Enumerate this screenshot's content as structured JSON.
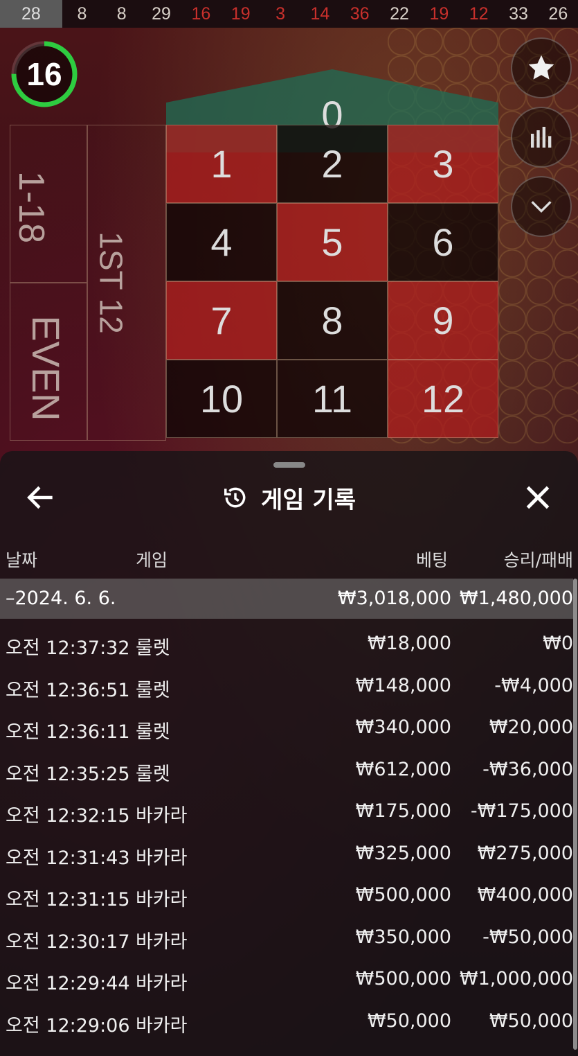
{
  "history_strip": [
    {
      "value": "28",
      "color": "current"
    },
    {
      "value": "8",
      "color": "black"
    },
    {
      "value": "8",
      "color": "black"
    },
    {
      "value": "29",
      "color": "black"
    },
    {
      "value": "16",
      "color": "red"
    },
    {
      "value": "19",
      "color": "red"
    },
    {
      "value": "3",
      "color": "red"
    },
    {
      "value": "14",
      "color": "red"
    },
    {
      "value": "36",
      "color": "red"
    },
    {
      "value": "22",
      "color": "black"
    },
    {
      "value": "19",
      "color": "red"
    },
    {
      "value": "12",
      "color": "red"
    },
    {
      "value": "33",
      "color": "black"
    },
    {
      "value": "26",
      "color": "black"
    }
  ],
  "timer": {
    "value": "16",
    "progress": 0.75,
    "color": "#2ecc40"
  },
  "board": {
    "zero": "0",
    "numbers": [
      {
        "n": "1",
        "color": "red"
      },
      {
        "n": "2",
        "color": "black"
      },
      {
        "n": "3",
        "color": "red"
      },
      {
        "n": "4",
        "color": "black"
      },
      {
        "n": "5",
        "color": "red"
      },
      {
        "n": "6",
        "color": "black"
      },
      {
        "n": "7",
        "color": "red"
      },
      {
        "n": "8",
        "color": "black"
      },
      {
        "n": "9",
        "color": "red"
      },
      {
        "n": "10",
        "color": "black"
      },
      {
        "n": "11",
        "color": "black"
      },
      {
        "n": "12",
        "color": "red"
      }
    ],
    "low_label": "1-18",
    "even_label": "EVEN",
    "dozen_label": "1ST 12"
  },
  "right_buttons": [
    "star-icon",
    "stats-icon",
    "chevron-down-icon"
  ],
  "sheet": {
    "title": "게임 기록",
    "columns": {
      "date": "날짜",
      "game": "게임",
      "bet": "베팅",
      "result": "승리/패배"
    },
    "summary": {
      "date": "–2024. 6. 6.",
      "bet": "₩3,018,000",
      "result": "₩1,480,000"
    },
    "rows": [
      {
        "time": "오전 12:37:32",
        "game": "룰렛",
        "bet": "₩18,000",
        "result": "₩0"
      },
      {
        "time": "오전 12:36:51",
        "game": "룰렛",
        "bet": "₩148,000",
        "result": "-₩4,000"
      },
      {
        "time": "오전 12:36:11",
        "game": "룰렛",
        "bet": "₩340,000",
        "result": "₩20,000"
      },
      {
        "time": "오전 12:35:25",
        "game": "룰렛",
        "bet": "₩612,000",
        "result": "-₩36,000"
      },
      {
        "time": "오전 12:32:15",
        "game": "바카라",
        "bet": "₩175,000",
        "result": "-₩175,000"
      },
      {
        "time": "오전 12:31:43",
        "game": "바카라",
        "bet": "₩325,000",
        "result": "₩275,000"
      },
      {
        "time": "오전 12:31:15",
        "game": "바카라",
        "bet": "₩500,000",
        "result": "₩400,000"
      },
      {
        "time": "오전 12:30:17",
        "game": "바카라",
        "bet": "₩350,000",
        "result": "-₩50,000"
      },
      {
        "time": "오전 12:29:44",
        "game": "바카라",
        "bet": "₩500,000",
        "result": "₩1,000,000"
      },
      {
        "time": "오전 12:29:06",
        "game": "바카라",
        "bet": "₩50,000",
        "result": "₩50,000"
      }
    ]
  }
}
